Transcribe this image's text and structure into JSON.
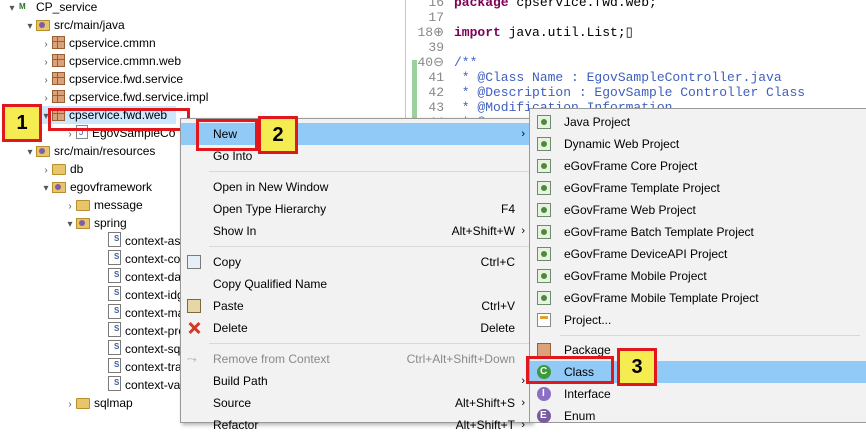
{
  "tree": {
    "items": [
      {
        "label": "CP_service",
        "arrow": "▾",
        "icon": "project-icon",
        "indent": 0
      },
      {
        "label": "src/main/java",
        "arrow": "▾",
        "icon": "source-folder-icon",
        "indent": 1
      },
      {
        "label": "cpservice.cmmn",
        "arrow": "›",
        "icon": "package-icon",
        "indent": 2
      },
      {
        "label": "cpservice.cmmn.web",
        "arrow": "›",
        "icon": "package-icon",
        "indent": 2
      },
      {
        "label": "cpservice.fwd.service",
        "arrow": "›",
        "icon": "package-icon",
        "indent": 2
      },
      {
        "label": "cpservice.fwd.service.impl",
        "arrow": "›",
        "icon": "package-icon",
        "indent": 2
      },
      {
        "label": "cpservice.fwd.web",
        "arrow": "▾",
        "icon": "package-icon",
        "indent": 2
      },
      {
        "label": "EgovSampleCo",
        "arrow": "›",
        "icon": "java-file-icon",
        "indent": 3
      },
      {
        "label": "src/main/resources",
        "arrow": "▾",
        "icon": "source-folder-icon",
        "indent": 1
      },
      {
        "label": "db",
        "arrow": "›",
        "icon": "folder-icon",
        "indent": 2
      },
      {
        "label": "egovframework",
        "arrow": "▾",
        "icon": "source-folder-icon",
        "indent": 2
      },
      {
        "label": "message",
        "arrow": "›",
        "icon": "folder-icon",
        "indent": 3
      },
      {
        "label": "spring",
        "arrow": "▾",
        "icon": "source-folder-icon",
        "indent": 3
      },
      {
        "label": "context-asp",
        "arrow": "",
        "icon": "xml-file-icon",
        "indent": 4
      },
      {
        "label": "context-cor",
        "arrow": "",
        "icon": "xml-file-icon",
        "indent": 4
      },
      {
        "label": "context-dat",
        "arrow": "",
        "icon": "xml-file-icon",
        "indent": 4
      },
      {
        "label": "context-idg",
        "arrow": "",
        "icon": "xml-file-icon",
        "indent": 4
      },
      {
        "label": "context-ma",
        "arrow": "",
        "icon": "xml-file-icon",
        "indent": 4
      },
      {
        "label": "context-pro",
        "arrow": "",
        "icon": "xml-file-icon",
        "indent": 4
      },
      {
        "label": "context-sql",
        "arrow": "",
        "icon": "xml-file-icon",
        "indent": 4
      },
      {
        "label": "context-tra",
        "arrow": "",
        "icon": "xml-file-icon",
        "indent": 4
      },
      {
        "label": "context-vali",
        "arrow": "",
        "icon": "xml-file-icon",
        "indent": 4
      },
      {
        "label": "sqlmap",
        "arrow": "›",
        "icon": "folder-icon",
        "indent": 3
      }
    ]
  },
  "editor": {
    "lines": [
      {
        "num": "16",
        "text": "package cpservice.fwd.web;",
        "kind": "pkg"
      },
      {
        "num": "17",
        "text": "",
        "kind": "plain"
      },
      {
        "num": "18⊕",
        "text": "import java.util.List;▯",
        "kind": "imp"
      },
      {
        "num": "39",
        "text": "",
        "kind": "plain"
      },
      {
        "num": "40⊖",
        "text": "/**",
        "kind": "cm"
      },
      {
        "num": "41",
        "text": " * @Class Name : EgovSampleController.java",
        "kind": "cm"
      },
      {
        "num": "42",
        "text": " * @Description : EgovSample Controller Class",
        "kind": "cm"
      },
      {
        "num": "43",
        "text": " * @Modification Information",
        "kind": "cm"
      },
      {
        "num": "44",
        "text": " * @",
        "kind": "cm"
      }
    ]
  },
  "context_menu": {
    "items": [
      {
        "label": "New",
        "shortcut": "",
        "submenu": true,
        "highlight": true,
        "icon": ""
      },
      {
        "label": "Go Into",
        "shortcut": "",
        "submenu": false,
        "icon": ""
      },
      {
        "sep": true
      },
      {
        "label": "Open in New Window",
        "shortcut": "",
        "submenu": false,
        "icon": ""
      },
      {
        "label": "Open Type Hierarchy",
        "shortcut": "F4",
        "submenu": false,
        "icon": ""
      },
      {
        "label": "Show In",
        "shortcut": "Alt+Shift+W",
        "submenu": true,
        "icon": ""
      },
      {
        "sep": true
      },
      {
        "label": "Copy",
        "shortcut": "Ctrl+C",
        "submenu": false,
        "icon": "copy-icon"
      },
      {
        "label": "Copy Qualified Name",
        "shortcut": "",
        "submenu": false,
        "icon": ""
      },
      {
        "label": "Paste",
        "shortcut": "Ctrl+V",
        "submenu": false,
        "icon": "paste-icon"
      },
      {
        "label": "Delete",
        "shortcut": "Delete",
        "submenu": false,
        "icon": "delete-icon"
      },
      {
        "sep": true
      },
      {
        "label": "Remove from Context",
        "shortcut": "Ctrl+Alt+Shift+Down",
        "submenu": false,
        "disabled": true,
        "icon": "remove-context-icon"
      },
      {
        "label": "Build Path",
        "shortcut": "",
        "submenu": true,
        "icon": ""
      },
      {
        "label": "Source",
        "shortcut": "Alt+Shift+S",
        "submenu": true,
        "icon": ""
      },
      {
        "label": "Refactor",
        "shortcut": "Alt+Shift+T",
        "submenu": true,
        "icon": ""
      }
    ]
  },
  "submenu": {
    "items": [
      {
        "label": "Java Project",
        "icon": "java-project-icon"
      },
      {
        "label": "Dynamic Web Project",
        "icon": "web-project-icon"
      },
      {
        "label": "eGovFrame Core Project",
        "icon": "egov-core-icon"
      },
      {
        "label": "eGovFrame Template Project",
        "icon": "egov-template-icon"
      },
      {
        "label": "eGovFrame Web Project",
        "icon": "egov-web-icon"
      },
      {
        "label": "eGovFrame Batch Template Project",
        "icon": "egov-batch-icon"
      },
      {
        "label": "eGovFrame DeviceAPI Project",
        "icon": "egov-device-icon"
      },
      {
        "label": "eGovFrame Mobile Project",
        "icon": "egov-mobile-icon"
      },
      {
        "label": "eGovFrame Mobile Template Project",
        "icon": "egov-mobile-template-icon"
      },
      {
        "label": "Project...",
        "icon": "project-generic-icon"
      },
      {
        "sep": true
      },
      {
        "label": "Package",
        "icon": "package-icon"
      },
      {
        "label": "Class",
        "icon": "class-icon",
        "highlight": true
      },
      {
        "label": "Interface",
        "icon": "interface-icon"
      },
      {
        "label": "Enum",
        "icon": "enum-icon"
      }
    ]
  },
  "callouts": {
    "one": "1",
    "two": "2",
    "three": "3"
  },
  "colors": {
    "highlight": "#91c9f7",
    "callout_bg": "#f5ec51",
    "callout_border": "#e0171c"
  }
}
